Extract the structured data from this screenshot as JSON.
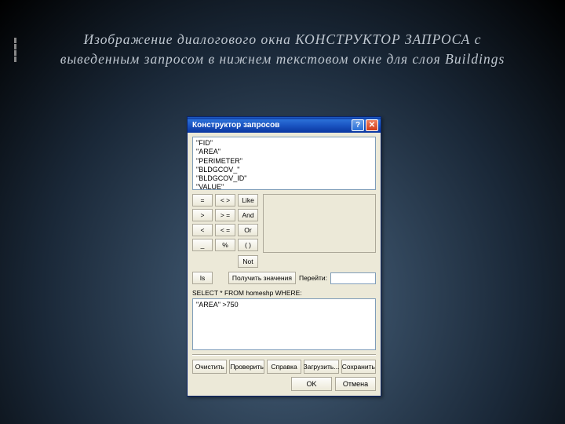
{
  "slide": {
    "title": "Изображение диалогового окна КОНСТРУКТОР ЗАПРОСА с выведенным запросом в нижнем текстовом окне для слоя Buildings"
  },
  "dialog": {
    "title": "Конструктор запросов",
    "fields": {
      "f0": "\"FID\"",
      "f1": "\"AREA\"",
      "f2": "\"PERIMETER\"",
      "f3": "\"BLDGCOV_\"",
      "f4": "\"BLDGCOV_ID\"",
      "f5": "\"VALUE\""
    },
    "ops": {
      "eq": "=",
      "ne": "< >",
      "like": "Like",
      "gt": ">",
      "ge": "> =",
      "and": "And",
      "lt": "<",
      "le": "< =",
      "or": "Or",
      "us": "_",
      "pct": "%",
      "paren": "( )",
      "not": "Not",
      "is": "Is"
    },
    "getvals": "Получить значения",
    "goto_label": "Перейти:",
    "select_label": "SELECT * FROM homeshp WHERE:",
    "query_text": "\"AREA\" >750",
    "buttons": {
      "clear": "Очистить",
      "verify": "Проверить",
      "help": "Справка",
      "load": "Загрузить...",
      "save": "Сохранить",
      "ok": "OK",
      "cancel": "Отмена"
    }
  }
}
